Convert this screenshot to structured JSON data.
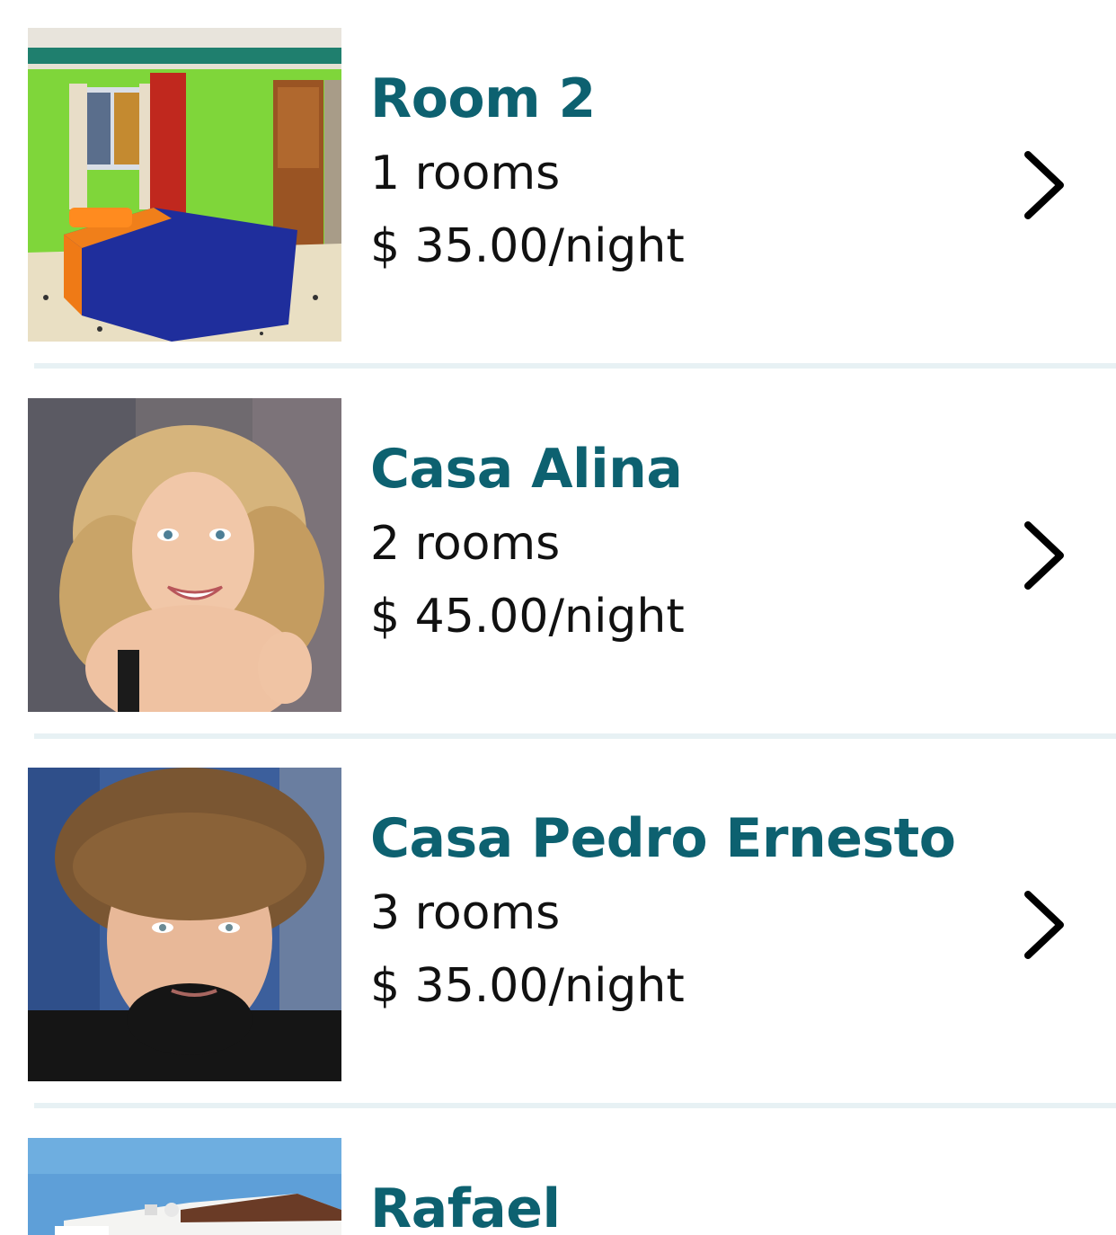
{
  "listings": [
    {
      "name": "Room 2",
      "rooms": "1 rooms",
      "price": "$ 35.00/night",
      "image": "bedroom-photo"
    },
    {
      "name": "Casa Alina",
      "rooms": "2 rooms",
      "price": "$ 45.00/night",
      "image": "woman-portrait-photo"
    },
    {
      "name": "Casa Pedro Ernesto",
      "rooms": "3 rooms",
      "price": "$ 35.00/night",
      "image": "man-portrait-photo"
    },
    {
      "name": "Rafael",
      "image": "house-exterior-photo"
    }
  ],
  "colors": {
    "title": "#0d6170",
    "text": "#111111",
    "divider": "#e7f1f4"
  },
  "icons": {
    "row_action": "chevron-right-icon"
  }
}
